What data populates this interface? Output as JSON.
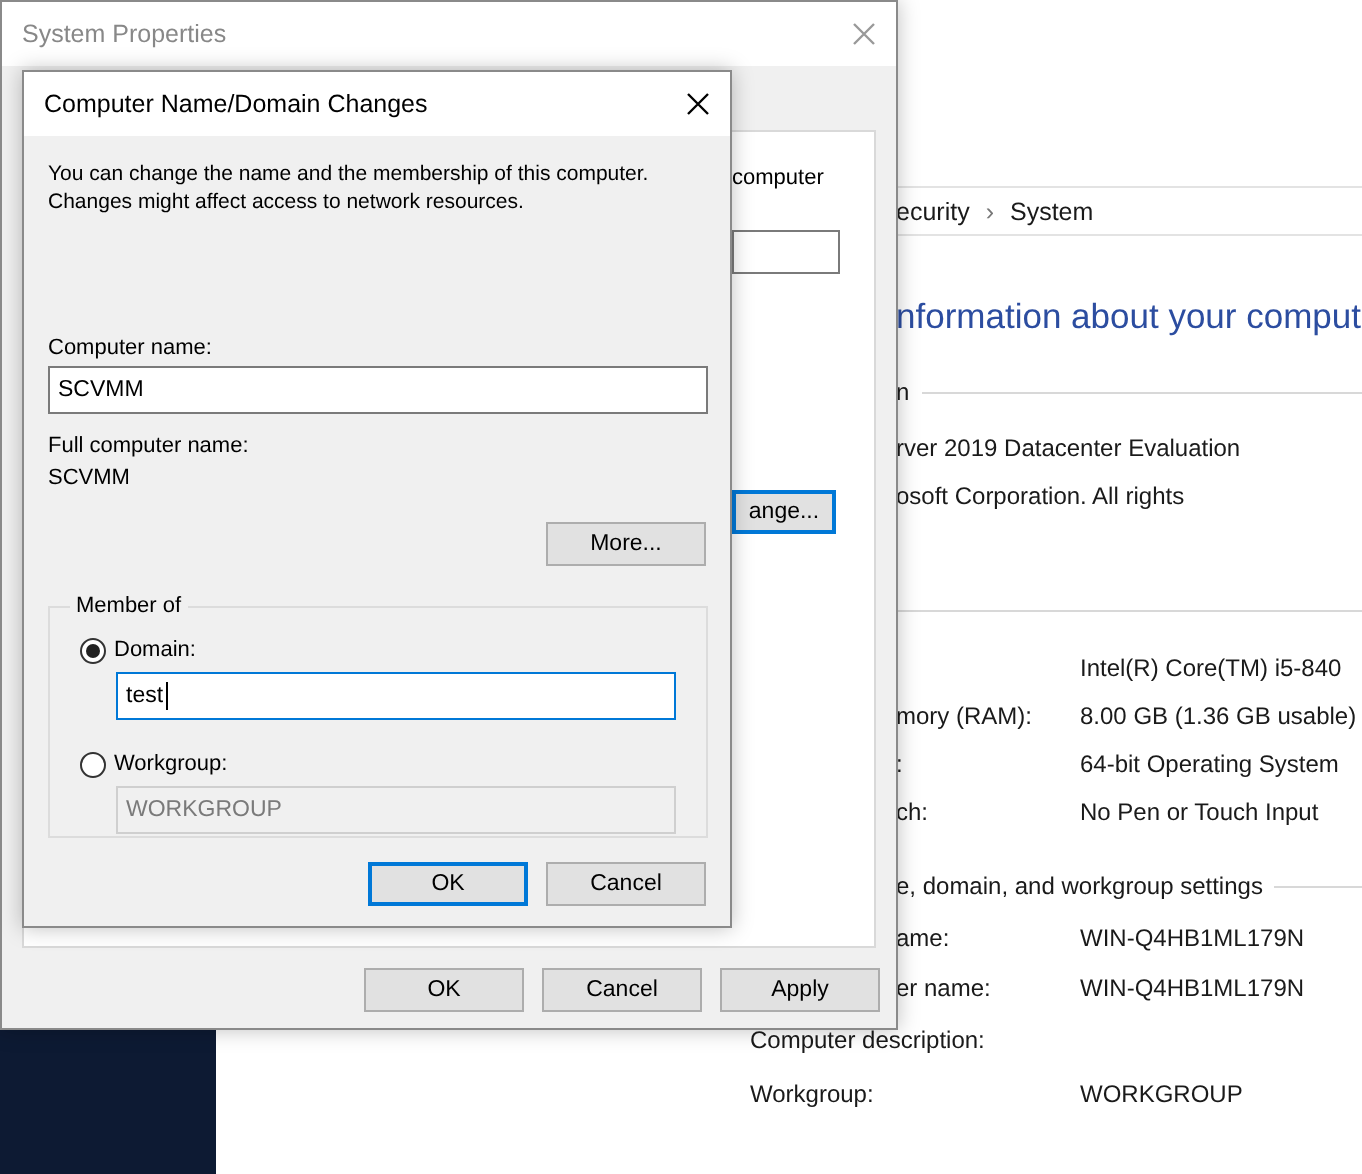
{
  "control_panel": {
    "breadcrumb": [
      "ecurity",
      "System"
    ],
    "separator": "›",
    "heading": "nformation about your comput",
    "edition": {
      "title": "n",
      "lines": [
        "rver 2019 Datacenter Evaluation",
        "osoft Corporation. All rights"
      ]
    },
    "system_rows": [
      {
        "label": "",
        "value": "Intel(R) Core(TM) i5-840"
      },
      {
        "label": "mory (RAM):",
        "value": "8.00 GB (1.36 GB usable)"
      },
      {
        "label": ":",
        "value": "64-bit Operating System"
      },
      {
        "label": "ch:",
        "value": "No Pen or Touch Input"
      }
    ],
    "settings": {
      "title": "e, domain, and workgroup settings",
      "rows": [
        {
          "label": "ame:",
          "value": "WIN-Q4HB1ML179N"
        },
        {
          "label": "er name:",
          "value": "WIN-Q4HB1ML179N"
        }
      ]
    },
    "uncovered_rows": [
      {
        "label": "Computer description:",
        "value": ""
      },
      {
        "label": "Workgroup:",
        "value": "WORKGROUP"
      }
    ]
  },
  "system_properties": {
    "title": "System Properties",
    "side_text": "computer",
    "change_button": {
      "label": "ange...",
      "focused": true
    },
    "buttons": [
      {
        "label": "OK",
        "focused": false
      },
      {
        "label": "Cancel",
        "focused": false
      },
      {
        "label": "Apply",
        "focused": false
      }
    ]
  },
  "dialog": {
    "title": "Computer Name/Domain Changes",
    "description": "You can change the name and the membership of this computer. Changes might affect access to network resources.",
    "computer_name": {
      "label": "Computer name:",
      "value": "SCVMM"
    },
    "full_name": {
      "label": "Full computer name:",
      "value": "SCVMM"
    },
    "more_button": "More...",
    "member_of": {
      "title": "Member of",
      "options": [
        {
          "label": "Domain:",
          "selected": true,
          "value": "test",
          "disabled": false,
          "focused": true
        },
        {
          "label": "Workgroup:",
          "selected": false,
          "value": "WORKGROUP",
          "disabled": true,
          "focused": false
        }
      ]
    },
    "buttons": [
      {
        "label": "OK",
        "focused": true
      },
      {
        "label": "Cancel",
        "focused": false
      }
    ]
  }
}
